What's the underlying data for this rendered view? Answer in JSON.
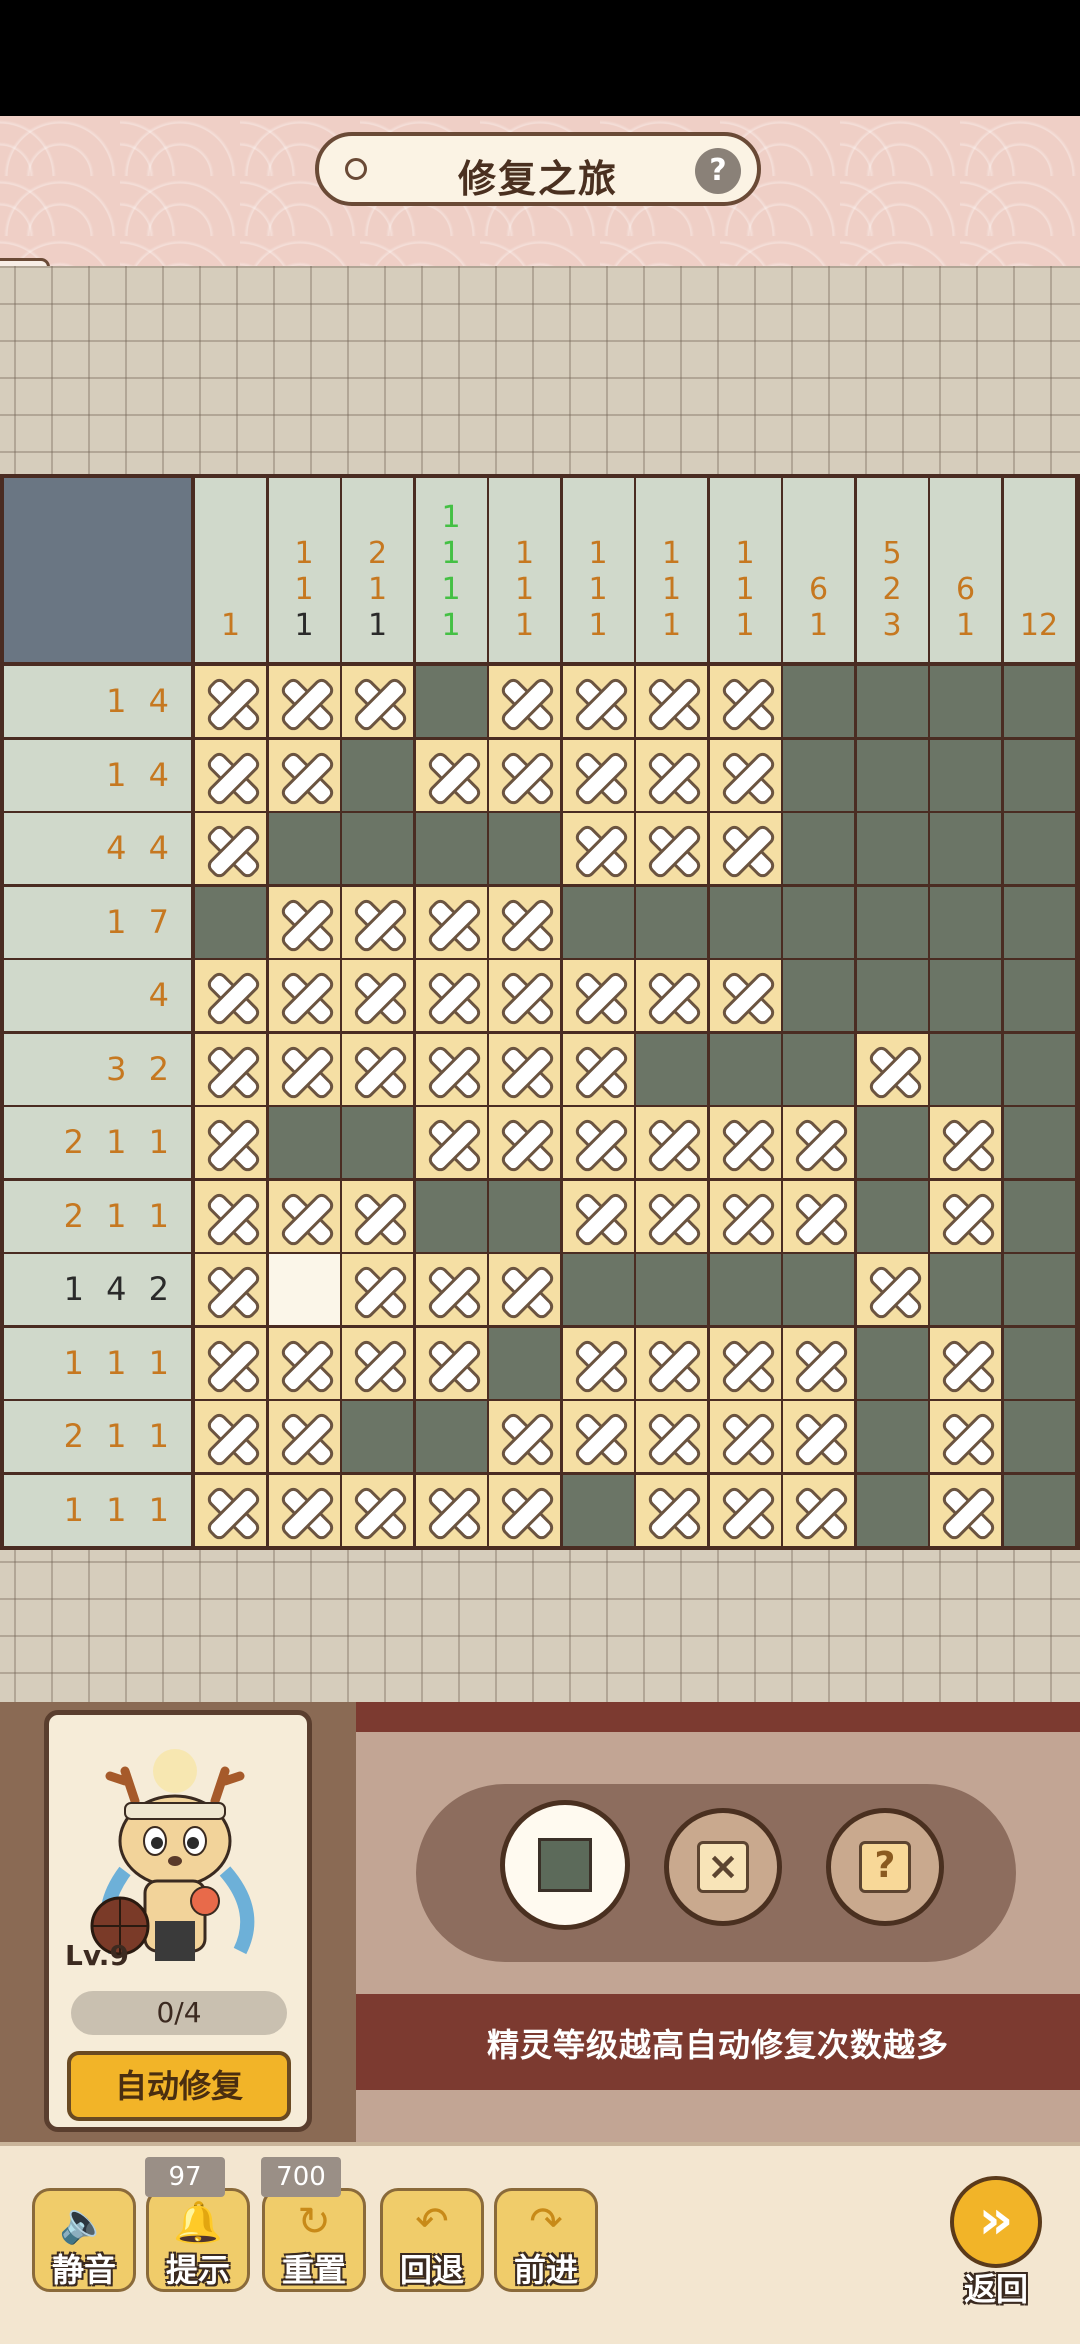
{
  "header": {
    "title": "修复之旅",
    "help_label": "?"
  },
  "column_clues": [
    [
      "1"
    ],
    [
      "1",
      "1",
      "1"
    ],
    [
      "2",
      "1",
      "1"
    ],
    [
      "1",
      "1",
      "1",
      "1"
    ],
    [
      "1",
      "1",
      "1"
    ],
    [
      "1",
      "1",
      "1"
    ],
    [
      "1",
      "1",
      "1"
    ],
    [
      "1",
      "1",
      "1"
    ],
    [
      "6",
      "1"
    ],
    [
      "5",
      "2",
      "3"
    ],
    [
      "6",
      "1"
    ],
    [
      "12"
    ]
  ],
  "column_clue_highlight": {
    "col_2_last": "#2a2a2a",
    "col_4": "#44c044"
  },
  "row_clues": [
    "1 4",
    "1 4",
    "4 4",
    "1 7",
    "4",
    "3 2",
    "2 1 1",
    "2 1 1",
    "1 4 2",
    "1 1 1",
    "2 1 1",
    "1 1 1"
  ],
  "row_clue_highlight": {
    "row_9": "#2a2a2a"
  },
  "grid": [
    "XXXFXXXXFFFF",
    "XXFXXXXXFFFF",
    "XFFFFXXXFFFF",
    "FXXXXFFFFFFF",
    "XXXXXXXXFFFF",
    "XXXXXXFFFXFF",
    "XFFXXXXXXFXF",
    "XXXFFXXXXFXF",
    "XEXXXFFFFXFF",
    "XXXXFXXXXFXF",
    "XXFFXXXXXFXF",
    "XXXXXFXXXFXF"
  ],
  "cell_colors": {
    "X": "#f5dfa4",
    "F": "#6b7566",
    "E": "#fbf6e9"
  },
  "sprite": {
    "level": "Lv.9",
    "progress": "0/4",
    "auto_repair_label": "自动修复"
  },
  "tools": {
    "fill": "fill-square",
    "cross": "×",
    "question": "?"
  },
  "tip": "精灵等级越高自动修复次数越多",
  "toolbar": [
    {
      "id": "mute",
      "label": "静音",
      "icon": "🔈"
    },
    {
      "id": "hint",
      "label": "提示",
      "icon": "🔔",
      "count": "97"
    },
    {
      "id": "reset",
      "label": "重置",
      "icon": "↻",
      "count": "700"
    },
    {
      "id": "undo",
      "label": "回退",
      "icon": "↶"
    },
    {
      "id": "redo",
      "label": "前进",
      "icon": "↷"
    }
  ],
  "back_label": "返回",
  "back_icon": "»"
}
